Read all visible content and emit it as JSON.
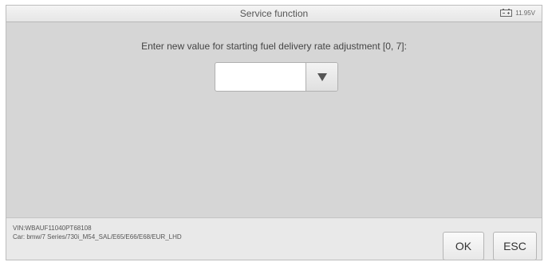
{
  "header": {
    "title": "Service function",
    "battery": {
      "icon": "battery-icon",
      "voltage": "11.95V"
    }
  },
  "main": {
    "prompt": "Enter new value for starting fuel delivery rate adjustment [0, 7]:",
    "dropdown": {
      "value": "",
      "icon": "triangle-down-icon"
    }
  },
  "footer": {
    "vin": "VIN:WBAUF11040PT68108",
    "car": "Car: bmw/7 Series/730i_M54_SAL/E65/E66/E68/EUR_LHD",
    "ok_label": "OK",
    "esc_label": "ESC"
  }
}
